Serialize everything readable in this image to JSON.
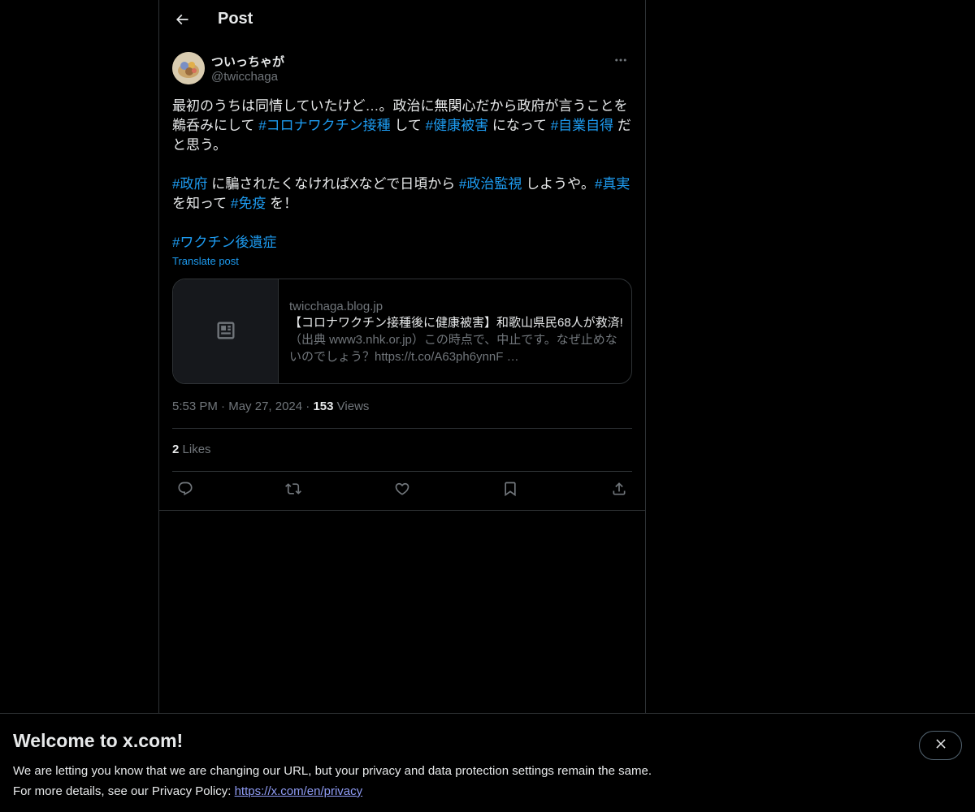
{
  "header": {
    "title": "Post"
  },
  "author": {
    "display_name": "ついっちゃが",
    "handle": "@twicchaga"
  },
  "tweet": {
    "p1": {
      "t1": "最初のうちは同情していたけど…。政治に無関心だから政府が言うことを鵜呑みにして ",
      "h1": "#コロナワクチン接種",
      "t2": " して ",
      "h2": "#健康被害",
      "t3": " になって ",
      "h3": "#自業自得",
      "t4": " だと思う。"
    },
    "p2": {
      "h1": "#政府",
      "t1": " に騙されたくなければXなどで日頃から ",
      "h2": "#政治監視",
      "t2": " しようや。",
      "h3": "#真実",
      "t3": " を知って ",
      "h4": "#免疫",
      "t4": " を！"
    },
    "p3": {
      "h1": "#ワクチン後遺症"
    },
    "translate_label": "Translate post"
  },
  "card": {
    "domain": "twicchaga.blog.jp",
    "title": "【コロナワクチン接種後に健康被害】和歌山県民68人が救済!",
    "description": "（出典 www3.nhk.or.jp）この時点で、中止です。なぜ止めないのでしょう？https://t.co/A63ph6ynnF …"
  },
  "meta": {
    "time": "5:53 PM",
    "sep1": "·",
    "date": "May 27, 2024",
    "sep2": "·",
    "views_count": "153",
    "views_label": "Views"
  },
  "likes": {
    "count": "2",
    "label": "Likes"
  },
  "icons": {
    "back": "arrow-left-icon",
    "more": "more-horizontal-icon",
    "card": "article-icon",
    "reply": "reply-icon",
    "repost": "repost-icon",
    "like": "heart-icon",
    "bookmark": "bookmark-icon",
    "share": "share-icon",
    "close": "close-icon"
  },
  "banner": {
    "title": "Welcome to x.com!",
    "line1": "We are letting you know that we are changing our URL, but your privacy and data protection settings remain the same.",
    "line2_prefix": "For more details, see our Privacy Policy: ",
    "link": "https://x.com/en/privacy"
  },
  "colors": {
    "background": "#000000",
    "accent": "#1d9bf0",
    "text": "#e7e9ea",
    "muted": "#71767b",
    "border": "#2f3336"
  }
}
